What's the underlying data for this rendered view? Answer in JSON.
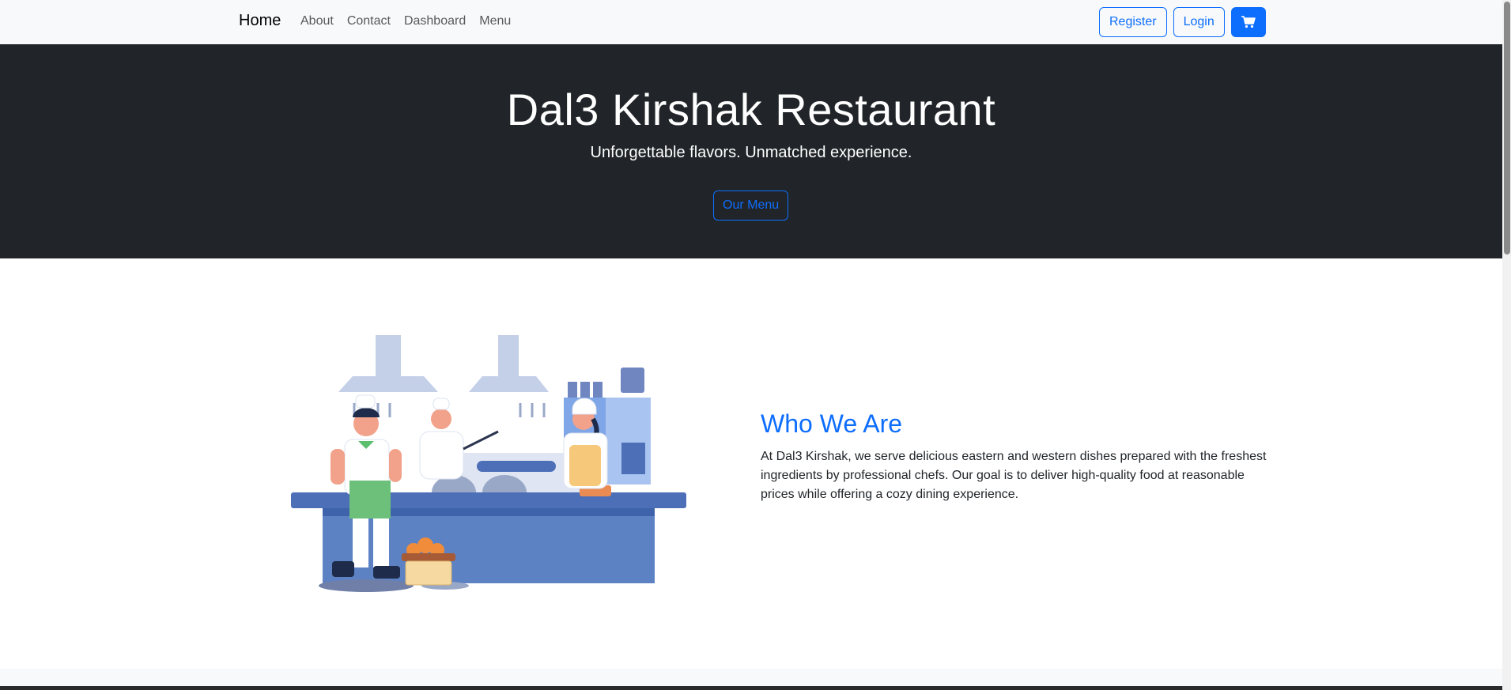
{
  "navbar": {
    "brand": "Home",
    "links": [
      "About",
      "Contact",
      "Dashboard",
      "Menu"
    ],
    "register_label": "Register",
    "login_label": "Login",
    "cart_icon": "cart-icon"
  },
  "hero": {
    "title": "Dal3 Kirshak Restaurant",
    "subtitle": "Unforgettable flavors. Unmatched experience.",
    "button_label": "Our Menu"
  },
  "about": {
    "title": "Who We Are",
    "text": "At Dal3 Kirshak, we serve delicious eastern and western dishes prepared with the freshest ingredients by professional chefs. Our goal is to deliver high-quality food at reasonable prices while offering a cozy dining experience."
  },
  "colors": {
    "primary": "#0d6efd",
    "hero_bg": "#212529",
    "navbar_bg": "#f8f9fa"
  }
}
